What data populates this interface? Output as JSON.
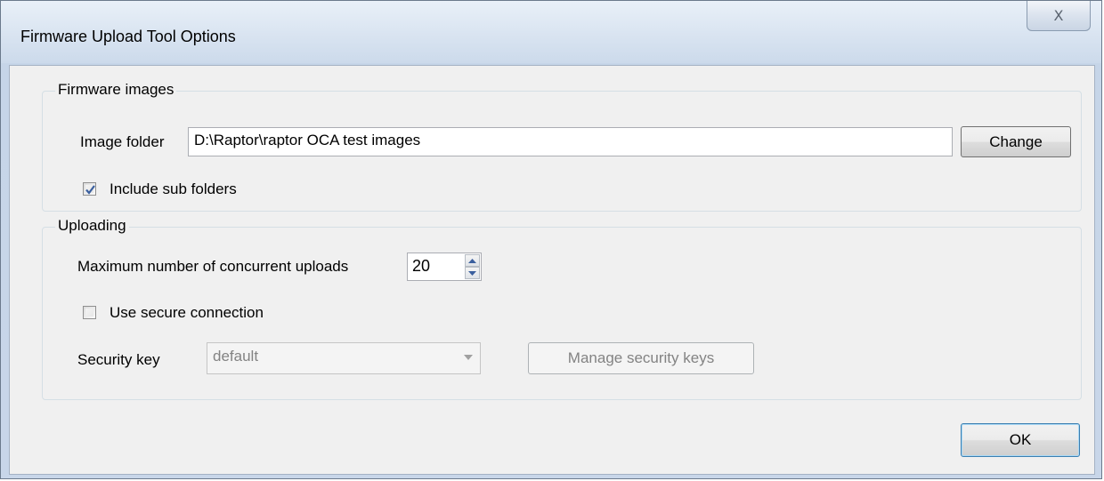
{
  "window": {
    "title": "Firmware Upload Tool Options",
    "close_glyph": "X"
  },
  "firmware_images": {
    "group_label": "Firmware images",
    "image_folder_label": "Image folder",
    "image_folder_value": "D:\\Raptor\\raptor OCA test images",
    "change_label": "Change",
    "include_subfolders_label": "Include sub folders",
    "include_subfolders_checked": true
  },
  "uploading": {
    "group_label": "Uploading",
    "max_concurrent_label": "Maximum number of concurrent uploads",
    "max_concurrent_value": "20",
    "secure_connection_label": "Use secure connection",
    "secure_connection_checked": false,
    "security_key_label": "Security key",
    "security_key_value": "default",
    "manage_keys_label": "Manage security keys"
  },
  "footer": {
    "ok_label": "OK"
  },
  "colors": {
    "client_bg": "#f0f0f0",
    "title_bg": "#d9e4f1",
    "check_blue": "#3a5f9e"
  }
}
